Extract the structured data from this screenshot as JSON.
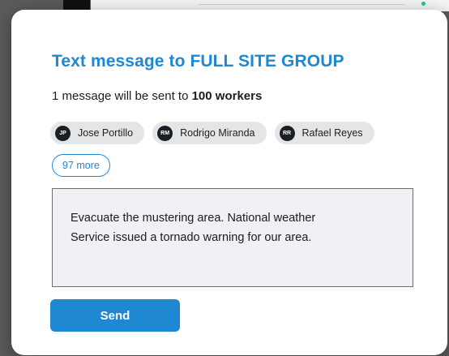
{
  "modal": {
    "title": "Text message to FULL SITE GROUP",
    "subtitle_prefix": "1 message will be sent to ",
    "subtitle_count": "100 workers",
    "recipients": [
      {
        "initials": "JP",
        "name": "Jose Portillo"
      },
      {
        "initials": "RM",
        "name": "Rodrigo Miranda"
      },
      {
        "initials": "RR",
        "name": "Rafael Reyes"
      }
    ],
    "more_label": "97 more",
    "message": "Evacuate the mustering area. National weather\nService issued a tornado warning for our area.",
    "send_label": "Send"
  },
  "colors": {
    "accent": "#1e88d2",
    "chip_bg": "#e4e5e7",
    "avatar_bg": "#1b1e24",
    "message_bg": "#f0f1f4"
  }
}
